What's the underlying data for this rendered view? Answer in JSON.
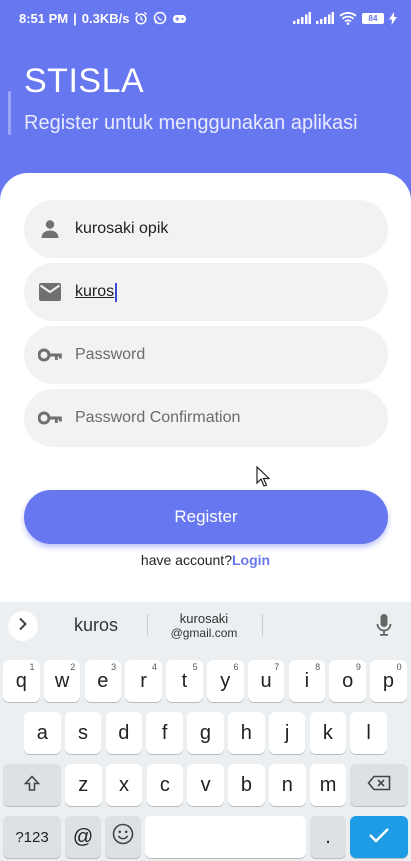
{
  "status_bar": {
    "time": "8:51 PM",
    "network_speed": "0.3KB/s",
    "battery": "84",
    "icons": [
      "alarm-icon",
      "whatsapp-icon",
      "game-icon",
      "signal-icon",
      "signal-icon",
      "wifi-icon",
      "battery-icon",
      "charging-icon"
    ]
  },
  "header": {
    "title": "STISLA",
    "subtitle": "Register untuk menggunakan aplikasi"
  },
  "form": {
    "name": {
      "value": "kurosaki opik",
      "icon": "person-icon"
    },
    "email": {
      "value": "kuros",
      "icon": "email-icon"
    },
    "password": {
      "placeholder": "Password",
      "icon": "key-icon"
    },
    "password_confirmation": {
      "placeholder": "Password Confirmation",
      "icon": "key-icon"
    },
    "register_label": "Register",
    "have_account": "have account?",
    "login_label": "Login"
  },
  "keyboard": {
    "suggestions": [
      "kuros",
      "kurosaki",
      "@gmail.com"
    ],
    "row1": [
      {
        "k": "q",
        "h": "1"
      },
      {
        "k": "w",
        "h": "2"
      },
      {
        "k": "e",
        "h": "3"
      },
      {
        "k": "r",
        "h": "4"
      },
      {
        "k": "t",
        "h": "5"
      },
      {
        "k": "y",
        "h": "6"
      },
      {
        "k": "u",
        "h": "7"
      },
      {
        "k": "i",
        "h": "8"
      },
      {
        "k": "o",
        "h": "9"
      },
      {
        "k": "p",
        "h": "0"
      }
    ],
    "row2": [
      "a",
      "s",
      "d",
      "f",
      "g",
      "h",
      "j",
      "k",
      "l"
    ],
    "row3": [
      "z",
      "x",
      "c",
      "v",
      "b",
      "n",
      "m"
    ],
    "symbols_label": "?123",
    "at_label": "@",
    "period_label": "."
  },
  "colors": {
    "primary": "#6777ef",
    "field_bg": "#f2f2f2",
    "keyboard_bg": "#eceff1",
    "enter_key": "#1e9be5"
  }
}
